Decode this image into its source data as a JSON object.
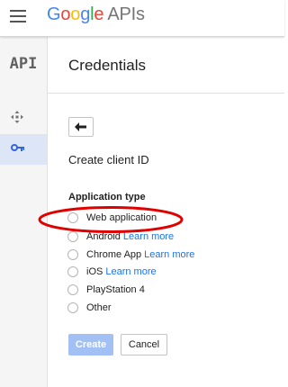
{
  "header": {
    "logo_letters": [
      "G",
      "o",
      "o",
      "g",
      "l",
      "e"
    ],
    "logo_suffix": "APIs"
  },
  "sidebar": {
    "api_logo": "API",
    "items": [
      {
        "icon": "dashboard-move-icon",
        "active": false
      },
      {
        "icon": "key-icon",
        "active": true
      }
    ]
  },
  "main": {
    "page_title": "Credentials",
    "subheading": "Create client ID",
    "field_label": "Application type",
    "options": [
      {
        "label": "Web application",
        "link": ""
      },
      {
        "label": "Android",
        "link": "Learn more"
      },
      {
        "label": "Chrome App",
        "link": "Learn more"
      },
      {
        "label": "iOS",
        "link": "Learn more"
      },
      {
        "label": "PlayStation 4",
        "link": ""
      },
      {
        "label": "Other",
        "link": ""
      }
    ],
    "create_label": "Create",
    "cancel_label": "Cancel"
  },
  "colors": {
    "accent": "#4285f4",
    "link": "#1a73e8",
    "annotation": "#e00000",
    "disabled_button": "#a2c0f4",
    "sidebar_active": "#dde6f6"
  }
}
